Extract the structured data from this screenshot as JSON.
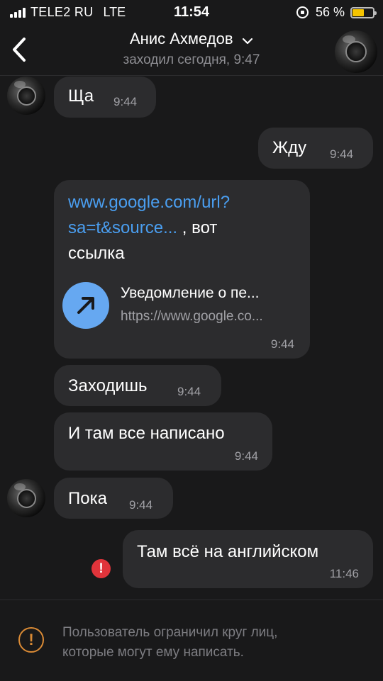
{
  "status_bar": {
    "carrier": "TELE2 RU",
    "network": "LTE",
    "time": "11:54",
    "battery_percent": "56 %",
    "battery_level": 0.56,
    "battery_color": "#f5c400"
  },
  "header": {
    "title": "Анис Ахмедов",
    "subtitle": "заходил сегодня, 9:47",
    "back_icon": "chevron-left-icon",
    "dropdown_icon": "chevron-down-icon"
  },
  "messages": [
    {
      "direction": "incoming",
      "text": "Ща",
      "time": "9:44"
    },
    {
      "direction": "outgoing",
      "text": "Жду",
      "time": "9:44"
    },
    {
      "direction": "incoming",
      "link_text_1": "www.google.com/url?",
      "link_text_2": "sa=t&source...",
      "text_after_link": " , вот",
      "text_line_3": "ссылка",
      "preview": {
        "title": "Уведомление о пе...",
        "url": "https://www.google.co...",
        "icon": "arrow-up-right-icon"
      },
      "time": "9:44"
    },
    {
      "direction": "incoming",
      "text": "Заходишь",
      "time": "9:44"
    },
    {
      "direction": "incoming",
      "text": "И там все написано",
      "time": "9:44"
    },
    {
      "direction": "incoming",
      "text": "Пока",
      "time": "9:44"
    },
    {
      "direction": "outgoing",
      "text": "Там всё на английском",
      "time": "11:46",
      "status": "error"
    }
  ],
  "error_icon_text": "!",
  "footer": {
    "notice_line_1": "Пользователь ограничил круг лиц,",
    "notice_line_2": "которые могут ему написать.",
    "warning_icon_text": "!"
  },
  "colors": {
    "background": "#19191a",
    "bubble": "#2c2c2e",
    "link": "#4a9ef0",
    "error": "#e0343b",
    "warning": "#d98a35"
  }
}
